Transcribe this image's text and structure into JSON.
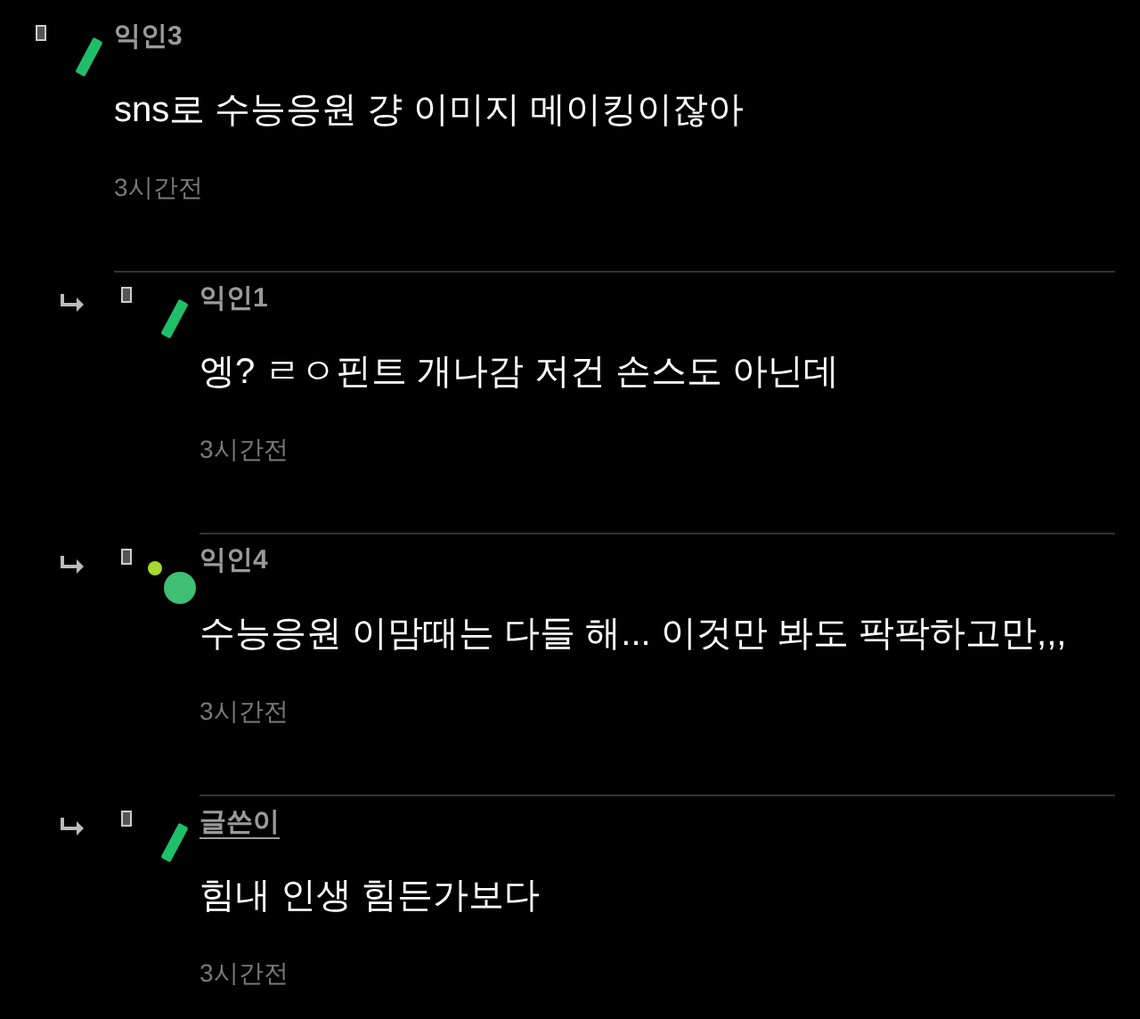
{
  "comments": [
    {
      "reply": false,
      "kind": "bar",
      "author": "익인3",
      "is_author": false,
      "text": "sns로 수능응원 걍 이미지 메이킹이잖아",
      "time": "3시간전"
    },
    {
      "reply": true,
      "kind": "bar",
      "author": "익인1",
      "is_author": false,
      "text": "엥? ㄹㅇ핀트 개나감 저건 손스도 아닌데",
      "time": "3시간전"
    },
    {
      "reply": true,
      "kind": "dots",
      "author": "익인4",
      "is_author": false,
      "text": "수능응원 이맘때는 다들 해... 이것만 봐도 팍팍하고만,,,",
      "time": "3시간전"
    },
    {
      "reply": true,
      "kind": "bar",
      "author": "글쓴이",
      "is_author": true,
      "text": "힘내 인생 힘든가보다",
      "time": "3시간전"
    }
  ]
}
